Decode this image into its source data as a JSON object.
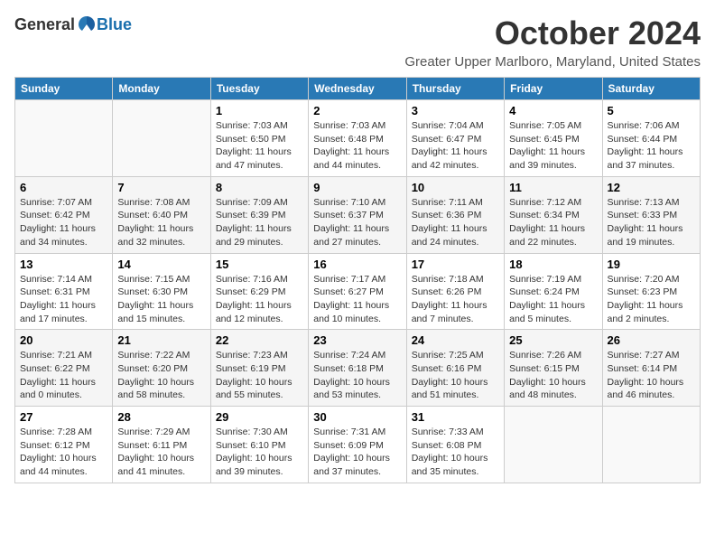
{
  "header": {
    "logo_general": "General",
    "logo_blue": "Blue",
    "title": "October 2024",
    "subtitle": "Greater Upper Marlboro, Maryland, United States"
  },
  "days_of_week": [
    "Sunday",
    "Monday",
    "Tuesday",
    "Wednesday",
    "Thursday",
    "Friday",
    "Saturday"
  ],
  "weeks": [
    [
      {
        "day": "",
        "content": ""
      },
      {
        "day": "",
        "content": ""
      },
      {
        "day": "1",
        "content": "Sunrise: 7:03 AM\nSunset: 6:50 PM\nDaylight: 11 hours and 47 minutes."
      },
      {
        "day": "2",
        "content": "Sunrise: 7:03 AM\nSunset: 6:48 PM\nDaylight: 11 hours and 44 minutes."
      },
      {
        "day": "3",
        "content": "Sunrise: 7:04 AM\nSunset: 6:47 PM\nDaylight: 11 hours and 42 minutes."
      },
      {
        "day": "4",
        "content": "Sunrise: 7:05 AM\nSunset: 6:45 PM\nDaylight: 11 hours and 39 minutes."
      },
      {
        "day": "5",
        "content": "Sunrise: 7:06 AM\nSunset: 6:44 PM\nDaylight: 11 hours and 37 minutes."
      }
    ],
    [
      {
        "day": "6",
        "content": "Sunrise: 7:07 AM\nSunset: 6:42 PM\nDaylight: 11 hours and 34 minutes."
      },
      {
        "day": "7",
        "content": "Sunrise: 7:08 AM\nSunset: 6:40 PM\nDaylight: 11 hours and 32 minutes."
      },
      {
        "day": "8",
        "content": "Sunrise: 7:09 AM\nSunset: 6:39 PM\nDaylight: 11 hours and 29 minutes."
      },
      {
        "day": "9",
        "content": "Sunrise: 7:10 AM\nSunset: 6:37 PM\nDaylight: 11 hours and 27 minutes."
      },
      {
        "day": "10",
        "content": "Sunrise: 7:11 AM\nSunset: 6:36 PM\nDaylight: 11 hours and 24 minutes."
      },
      {
        "day": "11",
        "content": "Sunrise: 7:12 AM\nSunset: 6:34 PM\nDaylight: 11 hours and 22 minutes."
      },
      {
        "day": "12",
        "content": "Sunrise: 7:13 AM\nSunset: 6:33 PM\nDaylight: 11 hours and 19 minutes."
      }
    ],
    [
      {
        "day": "13",
        "content": "Sunrise: 7:14 AM\nSunset: 6:31 PM\nDaylight: 11 hours and 17 minutes."
      },
      {
        "day": "14",
        "content": "Sunrise: 7:15 AM\nSunset: 6:30 PM\nDaylight: 11 hours and 15 minutes."
      },
      {
        "day": "15",
        "content": "Sunrise: 7:16 AM\nSunset: 6:29 PM\nDaylight: 11 hours and 12 minutes."
      },
      {
        "day": "16",
        "content": "Sunrise: 7:17 AM\nSunset: 6:27 PM\nDaylight: 11 hours and 10 minutes."
      },
      {
        "day": "17",
        "content": "Sunrise: 7:18 AM\nSunset: 6:26 PM\nDaylight: 11 hours and 7 minutes."
      },
      {
        "day": "18",
        "content": "Sunrise: 7:19 AM\nSunset: 6:24 PM\nDaylight: 11 hours and 5 minutes."
      },
      {
        "day": "19",
        "content": "Sunrise: 7:20 AM\nSunset: 6:23 PM\nDaylight: 11 hours and 2 minutes."
      }
    ],
    [
      {
        "day": "20",
        "content": "Sunrise: 7:21 AM\nSunset: 6:22 PM\nDaylight: 11 hours and 0 minutes."
      },
      {
        "day": "21",
        "content": "Sunrise: 7:22 AM\nSunset: 6:20 PM\nDaylight: 10 hours and 58 minutes."
      },
      {
        "day": "22",
        "content": "Sunrise: 7:23 AM\nSunset: 6:19 PM\nDaylight: 10 hours and 55 minutes."
      },
      {
        "day": "23",
        "content": "Sunrise: 7:24 AM\nSunset: 6:18 PM\nDaylight: 10 hours and 53 minutes."
      },
      {
        "day": "24",
        "content": "Sunrise: 7:25 AM\nSunset: 6:16 PM\nDaylight: 10 hours and 51 minutes."
      },
      {
        "day": "25",
        "content": "Sunrise: 7:26 AM\nSunset: 6:15 PM\nDaylight: 10 hours and 48 minutes."
      },
      {
        "day": "26",
        "content": "Sunrise: 7:27 AM\nSunset: 6:14 PM\nDaylight: 10 hours and 46 minutes."
      }
    ],
    [
      {
        "day": "27",
        "content": "Sunrise: 7:28 AM\nSunset: 6:12 PM\nDaylight: 10 hours and 44 minutes."
      },
      {
        "day": "28",
        "content": "Sunrise: 7:29 AM\nSunset: 6:11 PM\nDaylight: 10 hours and 41 minutes."
      },
      {
        "day": "29",
        "content": "Sunrise: 7:30 AM\nSunset: 6:10 PM\nDaylight: 10 hours and 39 minutes."
      },
      {
        "day": "30",
        "content": "Sunrise: 7:31 AM\nSunset: 6:09 PM\nDaylight: 10 hours and 37 minutes."
      },
      {
        "day": "31",
        "content": "Sunrise: 7:33 AM\nSunset: 6:08 PM\nDaylight: 10 hours and 35 minutes."
      },
      {
        "day": "",
        "content": ""
      },
      {
        "day": "",
        "content": ""
      }
    ]
  ]
}
